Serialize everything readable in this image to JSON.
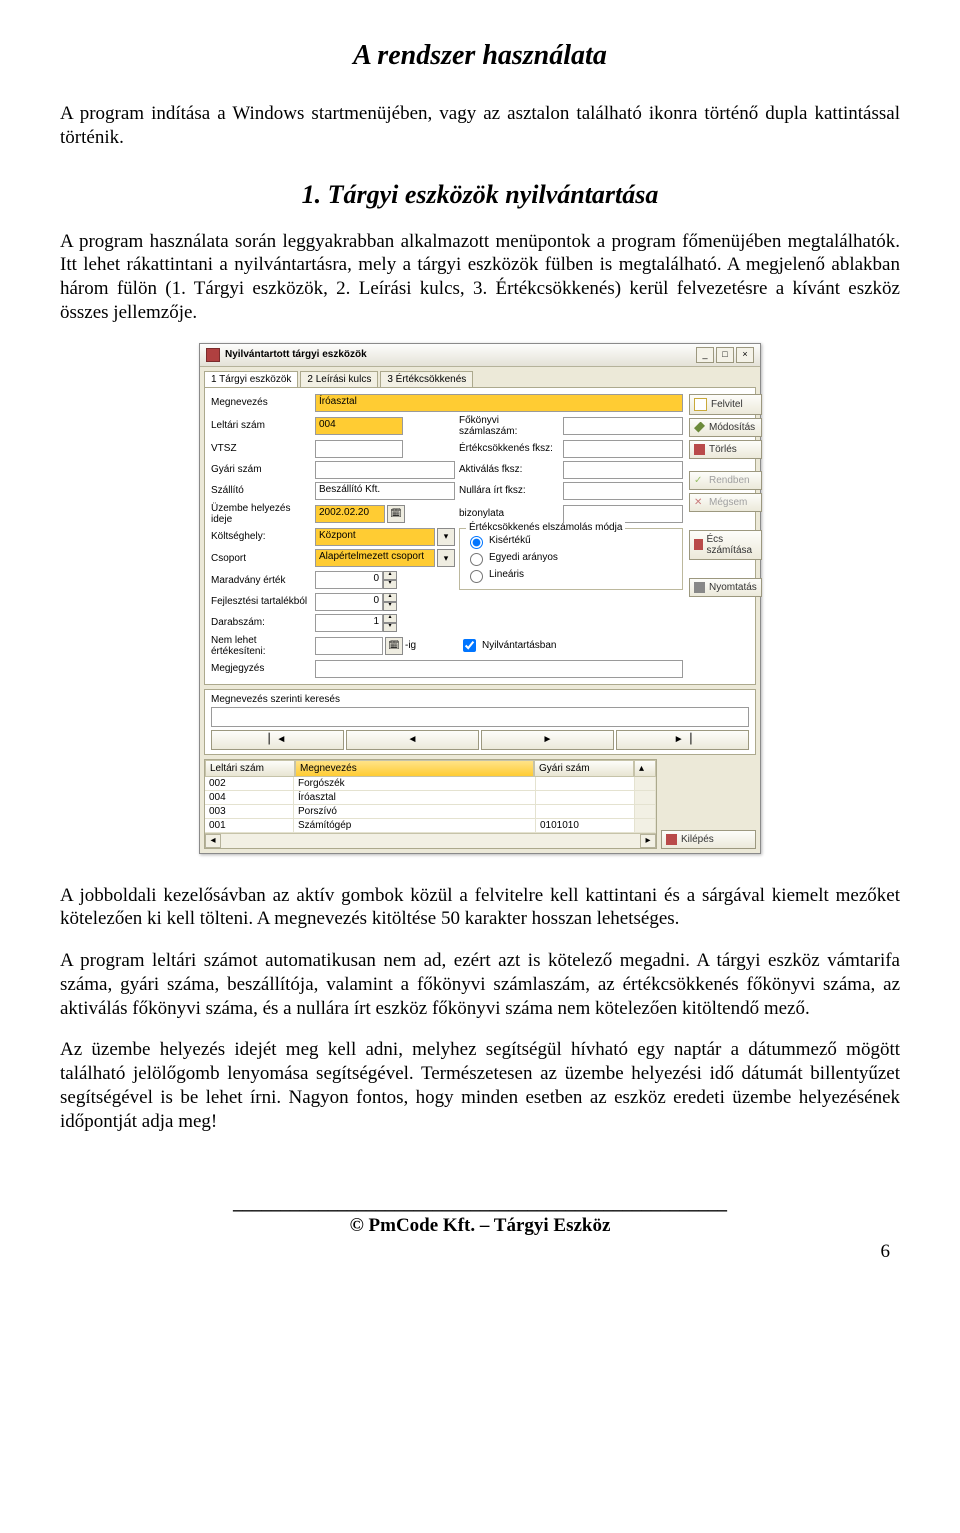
{
  "doc": {
    "title": "A rendszer használata",
    "intro": "A program indítása a Windows startmenüjében, vagy az asztalon található ikonra történő dupla kattintással történik.",
    "section": "1. Tárgyi eszközök nyilvántartása",
    "para1": "A program használata során leggyakrabban alkalmazott menüpontok a program főmenüjében megtalálhatók. Itt lehet rákattintani a nyilvántartásra, mely a tárgyi eszközök fülben is megtalálható. A megjelenő ablakban három fülön (1. Tárgyi eszközök, 2. Leírási kulcs, 3. Értékcsökkenés) kerül felvezetésre a kívánt eszköz összes jellemzője.",
    "para2": "A jobboldali kezelősávban az aktív gombok közül a felvitelre kell kattintani és a sárgával kiemelt mezőket kötelezően ki kell tölteni. A megnevezés kitöltése 50 karakter hosszan lehetséges.",
    "para3": "A program leltári számot automatikusan nem ad, ezért azt is kötelező megadni. A tárgyi eszköz vámtarifa száma, gyári száma, beszállítója, valamint a főkönyvi számlaszám, az értékcsökkenés főkönyvi száma, az aktiválás főkönyvi száma, és a nullára írt eszköz főkönyvi száma nem kötelezően kitöltendő mező.",
    "para4": "Az üzembe helyezés idejét meg kell adni, melyhez segítségül hívható egy naptár a dátummező mögött található jelölőgomb lenyomása segítségével. Természetesen az üzembe helyezési idő dátumát billentyűzet segítségével is be lehet írni. Nagyon fontos, hogy minden esetben az eszköz eredeti üzembe helyezésének időpontját adja meg!",
    "footer": "© PmCode Kft. – Tárgyi Eszköz",
    "page": "6"
  },
  "window": {
    "title": "Nyilvántartott tárgyi eszközök",
    "tabs": {
      "t1": "1 Tárgyi eszközök",
      "t2": "2 Leírási kulcs",
      "t3": "3 Értékcsökkenés"
    },
    "labels": {
      "megnevezes": "Megnevezés",
      "leltari": "Leltári szám",
      "vtsz": "VTSZ",
      "gyari": "Gyári szám",
      "szallito": "Szállító",
      "uzembe": "Üzembe helyezés ideje",
      "bizonylata": "bizonylata",
      "koltseghely": "Költséghely:",
      "csoport": "Csoport",
      "maradvany": "Maradvány érték",
      "fejlesztesi": "Fejlesztési tartalékból",
      "darabszam": "Darabszám:",
      "nemlehet": "Nem lehet értékesíteni:",
      "ig": "-ig",
      "megjegyzes": "Megjegyzés",
      "fokonyvi": "Főkönyvi számlaszám:",
      "ertek_fksz": "Értékcsökkenés fksz:",
      "aktiv_fksz": "Aktiválás fksz:",
      "nullara": "Nullára írt fksz:",
      "ecs_mod": "Értékcsökkenés elszámolás módja",
      "kiserteku": "Kisértékű",
      "egyedi": "Egyedi arányos",
      "linearis": "Lineáris",
      "nyilv": "Nyilvántartásban",
      "search": "Megnevezés szerinti keresés"
    },
    "values": {
      "megnevezes": "Íróasztal",
      "leltari": "004",
      "szallito": "Beszállító Kft.",
      "date": "2002.02.20",
      "koltseghely": "Központ",
      "csoport": "Alapértelmezett csoport",
      "maradvany": "0",
      "fejlesztesi": "0",
      "darabszam": "1"
    },
    "buttons": {
      "felvitel": "Felvitel",
      "modositas": "Módosítás",
      "torles": "Törlés",
      "rendben": "Rendben",
      "megsem": "Mégsem",
      "ecs": "Écs számítása",
      "nyomtatas": "Nyomtatás",
      "kilepes": "Kilépés"
    },
    "table": {
      "h1": "Leltári szám",
      "h2": "Megnevezés",
      "h3": "Gyári szám",
      "rows": [
        {
          "c0": "002",
          "c1": "Forgószék",
          "c2": ""
        },
        {
          "c0": "004",
          "c1": "Íróasztal",
          "c2": ""
        },
        {
          "c0": "003",
          "c1": "Porszívó",
          "c2": ""
        },
        {
          "c0": "001",
          "c1": "Számítógép",
          "c2": "0101010"
        }
      ]
    },
    "nav": {
      "first": "▏◄",
      "prev": "◄",
      "next": "►",
      "last": "►▕"
    }
  }
}
